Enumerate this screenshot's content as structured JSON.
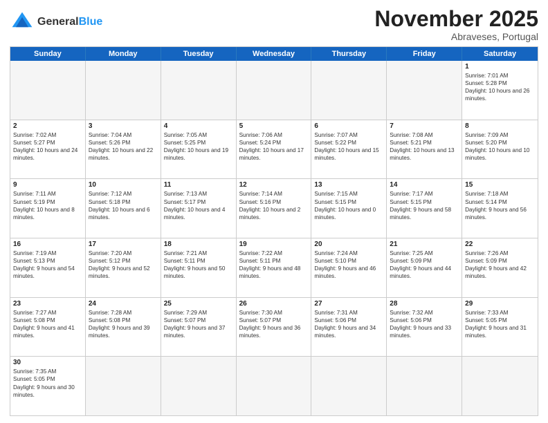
{
  "header": {
    "logo_general": "General",
    "logo_blue": "Blue",
    "month_year": "November 2025",
    "location": "Abraveses, Portugal"
  },
  "days_of_week": [
    "Sunday",
    "Monday",
    "Tuesday",
    "Wednesday",
    "Thursday",
    "Friday",
    "Saturday"
  ],
  "weeks": [
    [
      {
        "day": null,
        "empty": true
      },
      {
        "day": null,
        "empty": true
      },
      {
        "day": null,
        "empty": true
      },
      {
        "day": null,
        "empty": true
      },
      {
        "day": null,
        "empty": true
      },
      {
        "day": null,
        "empty": true
      },
      {
        "day": 1,
        "sunrise": "7:01 AM",
        "sunset": "5:28 PM",
        "daylight": "10 hours and 26 minutes."
      }
    ],
    [
      {
        "day": 2,
        "sunrise": "7:02 AM",
        "sunset": "5:27 PM",
        "daylight": "10 hours and 24 minutes."
      },
      {
        "day": 3,
        "sunrise": "7:04 AM",
        "sunset": "5:26 PM",
        "daylight": "10 hours and 22 minutes."
      },
      {
        "day": 4,
        "sunrise": "7:05 AM",
        "sunset": "5:25 PM",
        "daylight": "10 hours and 19 minutes."
      },
      {
        "day": 5,
        "sunrise": "7:06 AM",
        "sunset": "5:24 PM",
        "daylight": "10 hours and 17 minutes."
      },
      {
        "day": 6,
        "sunrise": "7:07 AM",
        "sunset": "5:22 PM",
        "daylight": "10 hours and 15 minutes."
      },
      {
        "day": 7,
        "sunrise": "7:08 AM",
        "sunset": "5:21 PM",
        "daylight": "10 hours and 13 minutes."
      },
      {
        "day": 8,
        "sunrise": "7:09 AM",
        "sunset": "5:20 PM",
        "daylight": "10 hours and 10 minutes."
      }
    ],
    [
      {
        "day": 9,
        "sunrise": "7:11 AM",
        "sunset": "5:19 PM",
        "daylight": "10 hours and 8 minutes."
      },
      {
        "day": 10,
        "sunrise": "7:12 AM",
        "sunset": "5:18 PM",
        "daylight": "10 hours and 6 minutes."
      },
      {
        "day": 11,
        "sunrise": "7:13 AM",
        "sunset": "5:17 PM",
        "daylight": "10 hours and 4 minutes."
      },
      {
        "day": 12,
        "sunrise": "7:14 AM",
        "sunset": "5:16 PM",
        "daylight": "10 hours and 2 minutes."
      },
      {
        "day": 13,
        "sunrise": "7:15 AM",
        "sunset": "5:15 PM",
        "daylight": "10 hours and 0 minutes."
      },
      {
        "day": 14,
        "sunrise": "7:17 AM",
        "sunset": "5:15 PM",
        "daylight": "9 hours and 58 minutes."
      },
      {
        "day": 15,
        "sunrise": "7:18 AM",
        "sunset": "5:14 PM",
        "daylight": "9 hours and 56 minutes."
      }
    ],
    [
      {
        "day": 16,
        "sunrise": "7:19 AM",
        "sunset": "5:13 PM",
        "daylight": "9 hours and 54 minutes."
      },
      {
        "day": 17,
        "sunrise": "7:20 AM",
        "sunset": "5:12 PM",
        "daylight": "9 hours and 52 minutes."
      },
      {
        "day": 18,
        "sunrise": "7:21 AM",
        "sunset": "5:11 PM",
        "daylight": "9 hours and 50 minutes."
      },
      {
        "day": 19,
        "sunrise": "7:22 AM",
        "sunset": "5:11 PM",
        "daylight": "9 hours and 48 minutes."
      },
      {
        "day": 20,
        "sunrise": "7:24 AM",
        "sunset": "5:10 PM",
        "daylight": "9 hours and 46 minutes."
      },
      {
        "day": 21,
        "sunrise": "7:25 AM",
        "sunset": "5:09 PM",
        "daylight": "9 hours and 44 minutes."
      },
      {
        "day": 22,
        "sunrise": "7:26 AM",
        "sunset": "5:09 PM",
        "daylight": "9 hours and 42 minutes."
      }
    ],
    [
      {
        "day": 23,
        "sunrise": "7:27 AM",
        "sunset": "5:08 PM",
        "daylight": "9 hours and 41 minutes."
      },
      {
        "day": 24,
        "sunrise": "7:28 AM",
        "sunset": "5:08 PM",
        "daylight": "9 hours and 39 minutes."
      },
      {
        "day": 25,
        "sunrise": "7:29 AM",
        "sunset": "5:07 PM",
        "daylight": "9 hours and 37 minutes."
      },
      {
        "day": 26,
        "sunrise": "7:30 AM",
        "sunset": "5:07 PM",
        "daylight": "9 hours and 36 minutes."
      },
      {
        "day": 27,
        "sunrise": "7:31 AM",
        "sunset": "5:06 PM",
        "daylight": "9 hours and 34 minutes."
      },
      {
        "day": 28,
        "sunrise": "7:32 AM",
        "sunset": "5:06 PM",
        "daylight": "9 hours and 33 minutes."
      },
      {
        "day": 29,
        "sunrise": "7:33 AM",
        "sunset": "5:05 PM",
        "daylight": "9 hours and 31 minutes."
      }
    ],
    [
      {
        "day": 30,
        "sunrise": "7:35 AM",
        "sunset": "5:05 PM",
        "daylight": "9 hours and 30 minutes."
      },
      {
        "day": null,
        "empty": true
      },
      {
        "day": null,
        "empty": true
      },
      {
        "day": null,
        "empty": true
      },
      {
        "day": null,
        "empty": true
      },
      {
        "day": null,
        "empty": true
      },
      {
        "day": null,
        "empty": true
      }
    ]
  ],
  "colors": {
    "header_bg": "#1565C0",
    "border": "#cccccc",
    "empty_bg": "#f5f5f5"
  },
  "labels": {
    "sunrise": "Sunrise:",
    "sunset": "Sunset:",
    "daylight": "Daylight:"
  }
}
